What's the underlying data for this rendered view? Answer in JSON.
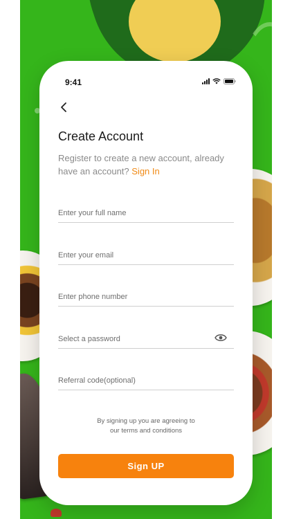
{
  "status_bar": {
    "time": "9:41"
  },
  "header": {
    "back_icon": "chevron-left-icon",
    "title": "Create Account",
    "subtitle": "Register to create a new account, already have an account?",
    "sign_in_link": "Sign In"
  },
  "form": {
    "full_name": {
      "placeholder": "Enter your full name",
      "value": ""
    },
    "email": {
      "placeholder": "Enter your email",
      "value": ""
    },
    "phone": {
      "placeholder": "Enter phone number",
      "value": ""
    },
    "password": {
      "placeholder": "Select a password",
      "value": "",
      "toggle_icon": "eye-icon"
    },
    "referral": {
      "placeholder": "Referral code(optional)",
      "value": ""
    }
  },
  "terms": {
    "line1": "By signing up you are agreeing to",
    "line2": "our terms and conditions"
  },
  "signup_button": {
    "label": "Sign  UP"
  },
  "colors": {
    "background_green": "#35b51b",
    "accent_orange": "#f7820d",
    "link_orange": "#f08a16",
    "yolk_yellow": "#f0cd54",
    "dark_green": "#1f6b1b"
  }
}
